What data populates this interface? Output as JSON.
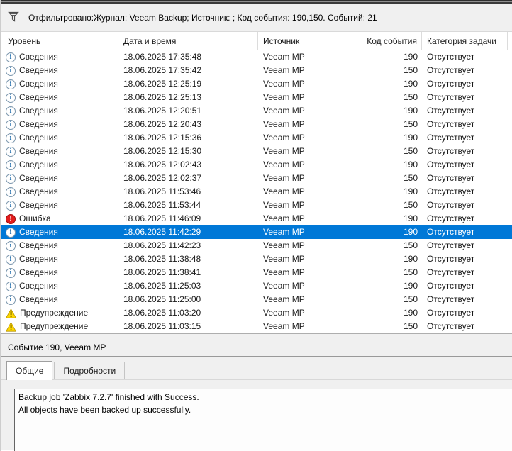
{
  "filter_bar": {
    "text": "Отфильтровано:Журнал: Veeam Backup; Источник: ; Код события: 190,150. Событий: 21"
  },
  "table": {
    "columns": {
      "level": "Уровень",
      "datetime": "Дата и время",
      "source": "Источник",
      "code": "Код события",
      "category": "Категория задачи"
    },
    "level_labels": {
      "info": "Сведения",
      "error": "Ошибка",
      "warning": "Предупреждение"
    },
    "rows": [
      {
        "level": "info",
        "datetime": "18.06.2025 17:35:48",
        "source": "Veeam MP",
        "code": "190",
        "category": "Отсутствует",
        "selected": false
      },
      {
        "level": "info",
        "datetime": "18.06.2025 17:35:42",
        "source": "Veeam MP",
        "code": "150",
        "category": "Отсутствует",
        "selected": false
      },
      {
        "level": "info",
        "datetime": "18.06.2025 12:25:19",
        "source": "Veeam MP",
        "code": "190",
        "category": "Отсутствует",
        "selected": false
      },
      {
        "level": "info",
        "datetime": "18.06.2025 12:25:13",
        "source": "Veeam MP",
        "code": "150",
        "category": "Отсутствует",
        "selected": false
      },
      {
        "level": "info",
        "datetime": "18.06.2025 12:20:51",
        "source": "Veeam MP",
        "code": "190",
        "category": "Отсутствует",
        "selected": false
      },
      {
        "level": "info",
        "datetime": "18.06.2025 12:20:43",
        "source": "Veeam MP",
        "code": "150",
        "category": "Отсутствует",
        "selected": false
      },
      {
        "level": "info",
        "datetime": "18.06.2025 12:15:36",
        "source": "Veeam MP",
        "code": "190",
        "category": "Отсутствует",
        "selected": false
      },
      {
        "level": "info",
        "datetime": "18.06.2025 12:15:30",
        "source": "Veeam MP",
        "code": "150",
        "category": "Отсутствует",
        "selected": false
      },
      {
        "level": "info",
        "datetime": "18.06.2025 12:02:43",
        "source": "Veeam MP",
        "code": "190",
        "category": "Отсутствует",
        "selected": false
      },
      {
        "level": "info",
        "datetime": "18.06.2025 12:02:37",
        "source": "Veeam MP",
        "code": "150",
        "category": "Отсутствует",
        "selected": false
      },
      {
        "level": "info",
        "datetime": "18.06.2025 11:53:46",
        "source": "Veeam MP",
        "code": "190",
        "category": "Отсутствует",
        "selected": false
      },
      {
        "level": "info",
        "datetime": "18.06.2025 11:53:44",
        "source": "Veeam MP",
        "code": "150",
        "category": "Отсутствует",
        "selected": false
      },
      {
        "level": "error",
        "datetime": "18.06.2025 11:46:09",
        "source": "Veeam MP",
        "code": "190",
        "category": "Отсутствует",
        "selected": false
      },
      {
        "level": "info",
        "datetime": "18.06.2025 11:42:29",
        "source": "Veeam MP",
        "code": "190",
        "category": "Отсутствует",
        "selected": true
      },
      {
        "level": "info",
        "datetime": "18.06.2025 11:42:23",
        "source": "Veeam MP",
        "code": "150",
        "category": "Отсутствует",
        "selected": false
      },
      {
        "level": "info",
        "datetime": "18.06.2025 11:38:48",
        "source": "Veeam MP",
        "code": "190",
        "category": "Отсутствует",
        "selected": false
      },
      {
        "level": "info",
        "datetime": "18.06.2025 11:38:41",
        "source": "Veeam MP",
        "code": "150",
        "category": "Отсутствует",
        "selected": false
      },
      {
        "level": "info",
        "datetime": "18.06.2025 11:25:03",
        "source": "Veeam MP",
        "code": "190",
        "category": "Отсутствует",
        "selected": false
      },
      {
        "level": "info",
        "datetime": "18.06.2025 11:25:00",
        "source": "Veeam MP",
        "code": "150",
        "category": "Отсутствует",
        "selected": false
      },
      {
        "level": "warning",
        "datetime": "18.06.2025 11:03:20",
        "source": "Veeam MP",
        "code": "190",
        "category": "Отсутствует",
        "selected": false
      },
      {
        "level": "warning",
        "datetime": "18.06.2025 11:03:15",
        "source": "Veeam MP",
        "code": "150",
        "category": "Отсутствует",
        "selected": false
      }
    ]
  },
  "detail": {
    "title": "Событие 190, Veeam MP",
    "tabs": [
      {
        "label": "Общие",
        "active": true
      },
      {
        "label": "Подробности",
        "active": false
      }
    ],
    "message_lines": [
      "Backup job 'Zabbix 7.2.7' finished with Success.",
      "All objects have been backed up successfully."
    ]
  },
  "colors": {
    "selection": "#0078d7",
    "info_icon": "#0b5ea2",
    "error_icon": "#e11d1d",
    "warning_icon": "#ffd800"
  }
}
